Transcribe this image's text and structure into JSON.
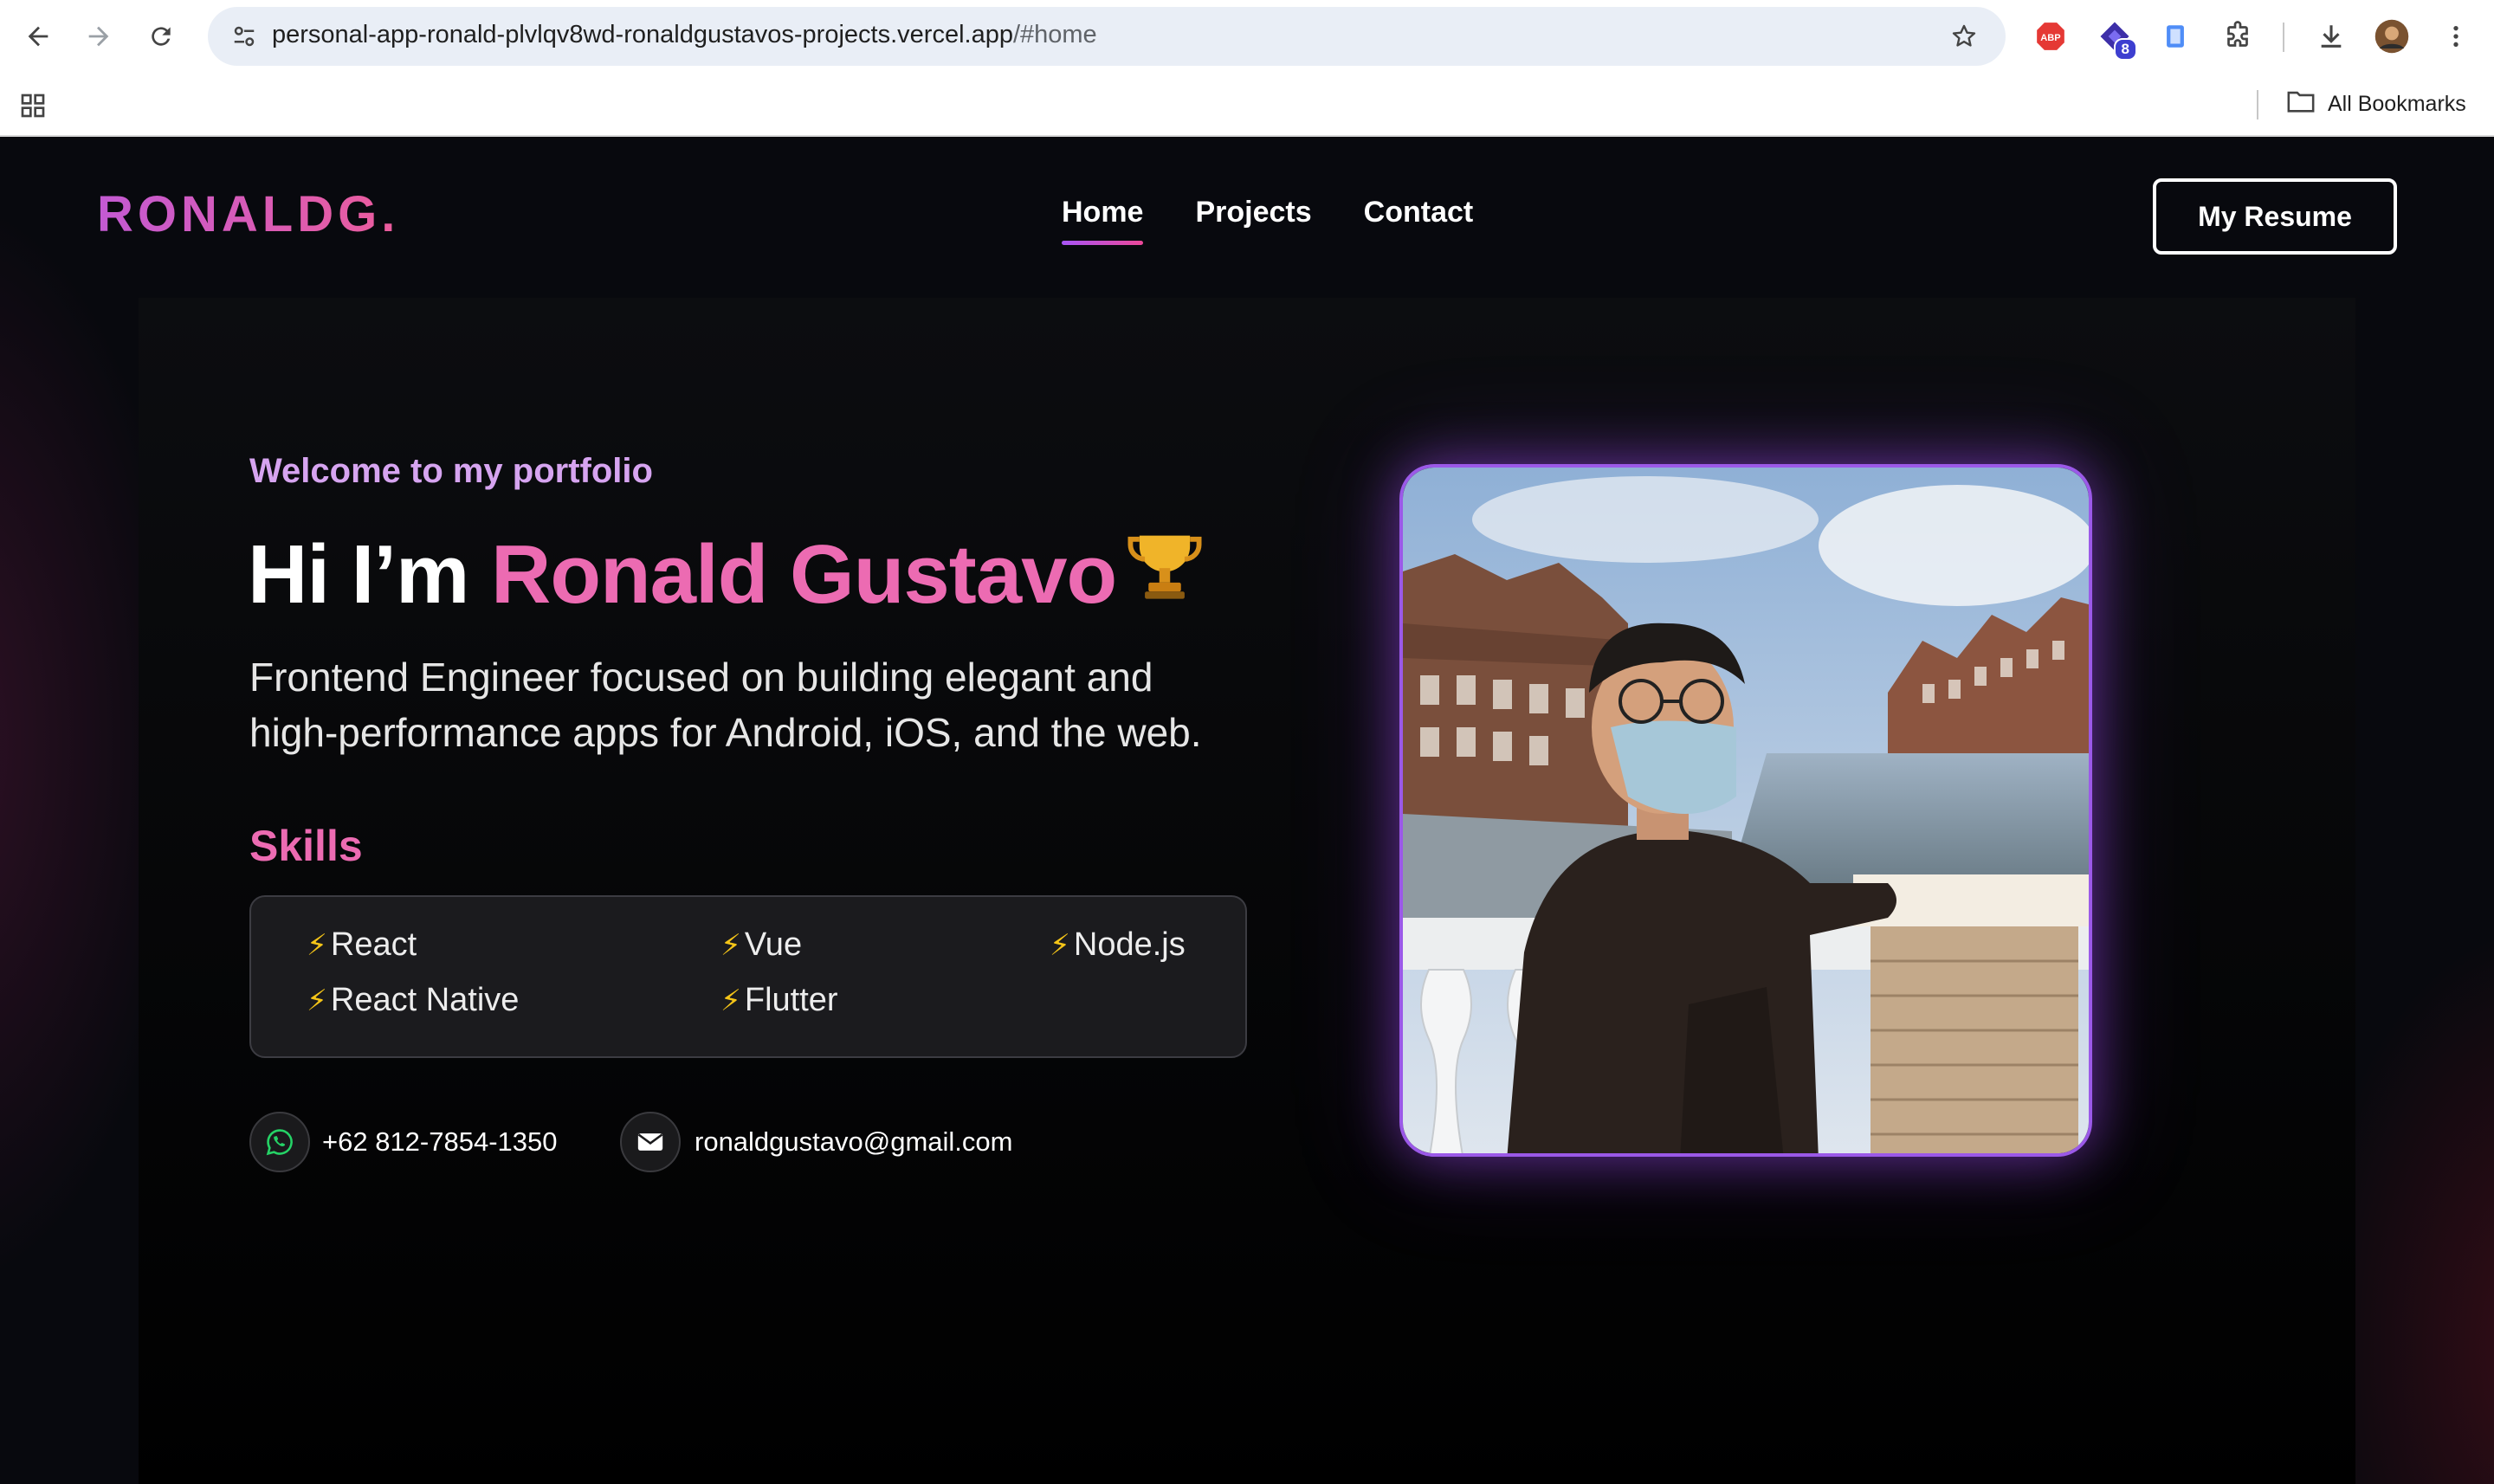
{
  "browser": {
    "url_host": "personal-app-ronald-plvlqv8wd-ronaldgustavos-projects.vercel.app",
    "url_path": "/#home",
    "extension_badge": "8",
    "bookmarks_label": "All Bookmarks",
    "icons": [
      "back-icon",
      "forward-icon",
      "reload-icon",
      "site-settings-icon",
      "star-icon",
      "adblock-icon",
      "extension-icon",
      "clipboard-icon",
      "puzzle-icon",
      "download-icon",
      "profile-avatar",
      "menu-icon",
      "apps-icon",
      "folder-icon"
    ]
  },
  "header": {
    "logo": "RONALDG.",
    "nav": [
      {
        "label": "Home",
        "active": true
      },
      {
        "label": "Projects",
        "active": false
      },
      {
        "label": "Contact",
        "active": false
      }
    ],
    "resume_button": "My Resume"
  },
  "hero": {
    "welcome": "Welcome to my portfolio",
    "title_prefix": "Hi I’m",
    "title_name": "Ronald Gustavo",
    "description_line1": "Frontend Engineer focused on building elegant and",
    "description_line2": "high-performance apps for Android, iOS, and the web.",
    "skills_heading": "Skills",
    "skills": [
      "React",
      "Vue",
      "Node.js",
      "React Native",
      "Flutter"
    ],
    "phone": "+62 812-7854-1350",
    "email": "ronaldgustavo@gmail.com"
  },
  "colors": {
    "accent_pink": "#ec6bb2",
    "accent_purple": "#9b59e8",
    "welcome_lilac": "#d6a4f0",
    "background": "#08090e"
  }
}
